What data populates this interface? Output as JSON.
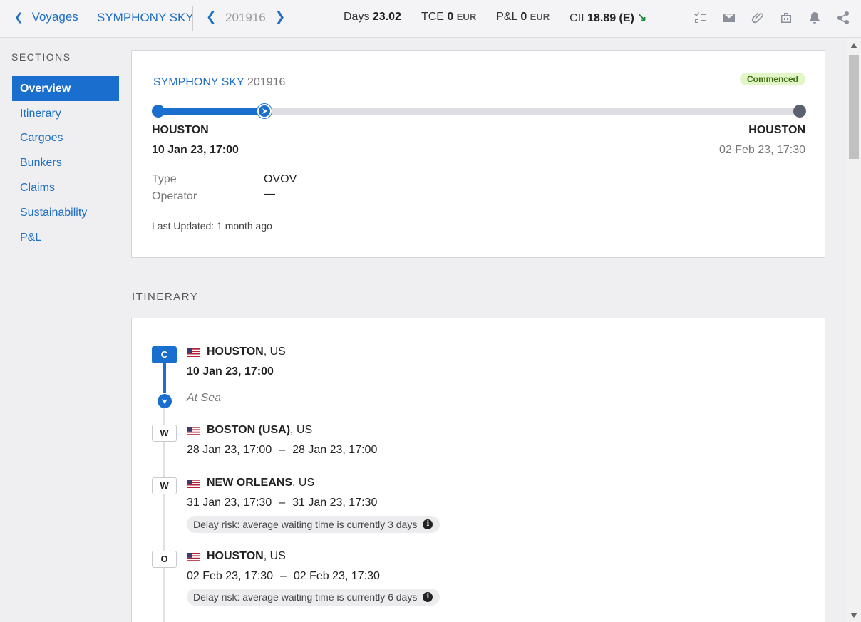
{
  "topbar": {
    "back_label": "Voyages",
    "vessel": "SYMPHONY SKY",
    "voyage_no": "201916",
    "metrics": [
      {
        "label": "Days",
        "value": "23.02",
        "unit": ""
      },
      {
        "label": "TCE",
        "value": "0",
        "unit": "EUR"
      },
      {
        "label": "P&L",
        "value": "0",
        "unit": "EUR"
      },
      {
        "label": "CII",
        "value": "18.89 (E)",
        "unit": ""
      }
    ],
    "cii_trend": "down",
    "icons": [
      "checklist-icon",
      "mail-icon",
      "attachment-icon",
      "briefcase-icon",
      "bell-icon",
      "share-icon"
    ]
  },
  "sidebar": {
    "title": "SECTIONS",
    "items": [
      {
        "label": "Overview",
        "active": true
      },
      {
        "label": "Itinerary"
      },
      {
        "label": "Cargoes"
      },
      {
        "label": "Bunkers"
      },
      {
        "label": "Claims"
      },
      {
        "label": "Sustainability"
      },
      {
        "label": "P&L"
      }
    ]
  },
  "overview": {
    "vessel": "SYMPHONY SKY",
    "voyage_no": "201916",
    "status": "Commenced",
    "progress": 0.165,
    "from_port": "HOUSTON",
    "from_date": "10 Jan 23, 17:00",
    "to_port": "HOUSTON",
    "to_date": "02 Feb 23, 17:30",
    "type_label": "Type",
    "type_value": "OVOV",
    "operator_label": "Operator",
    "operator_value": "—",
    "last_updated_label": "Last Updated:",
    "last_updated_value": "1 month ago"
  },
  "itinerary": {
    "title": "ITINERARY",
    "at_sea": "At Sea",
    "stops": [
      {
        "code": "C",
        "port": "HOUSTON",
        "country": ", US",
        "arrival": "10 Jan 23, 17:00",
        "departure": "",
        "risk": ""
      },
      {
        "code": "W",
        "port": "BOSTON (USA)",
        "country": ", US",
        "arrival": "28 Jan 23, 17:00",
        "departure": "28 Jan 23, 17:00",
        "risk": ""
      },
      {
        "code": "W",
        "port": "NEW ORLEANS",
        "country": ", US",
        "arrival": "31 Jan 23, 17:30",
        "departure": "31 Jan 23, 17:30",
        "risk": "Delay risk: average waiting time is currently 3 days"
      },
      {
        "code": "O",
        "port": "HOUSTON",
        "country": ", US",
        "arrival": "02 Feb 23, 17:30",
        "departure": "02 Feb 23, 17:30",
        "risk": "Delay risk: average waiting time is currently 6 days"
      }
    ],
    "separator": "–"
  },
  "colors": {
    "accent": "#1a6fce",
    "status_bg": "#e2f5c6",
    "trend_good": "#1c8a3a"
  }
}
